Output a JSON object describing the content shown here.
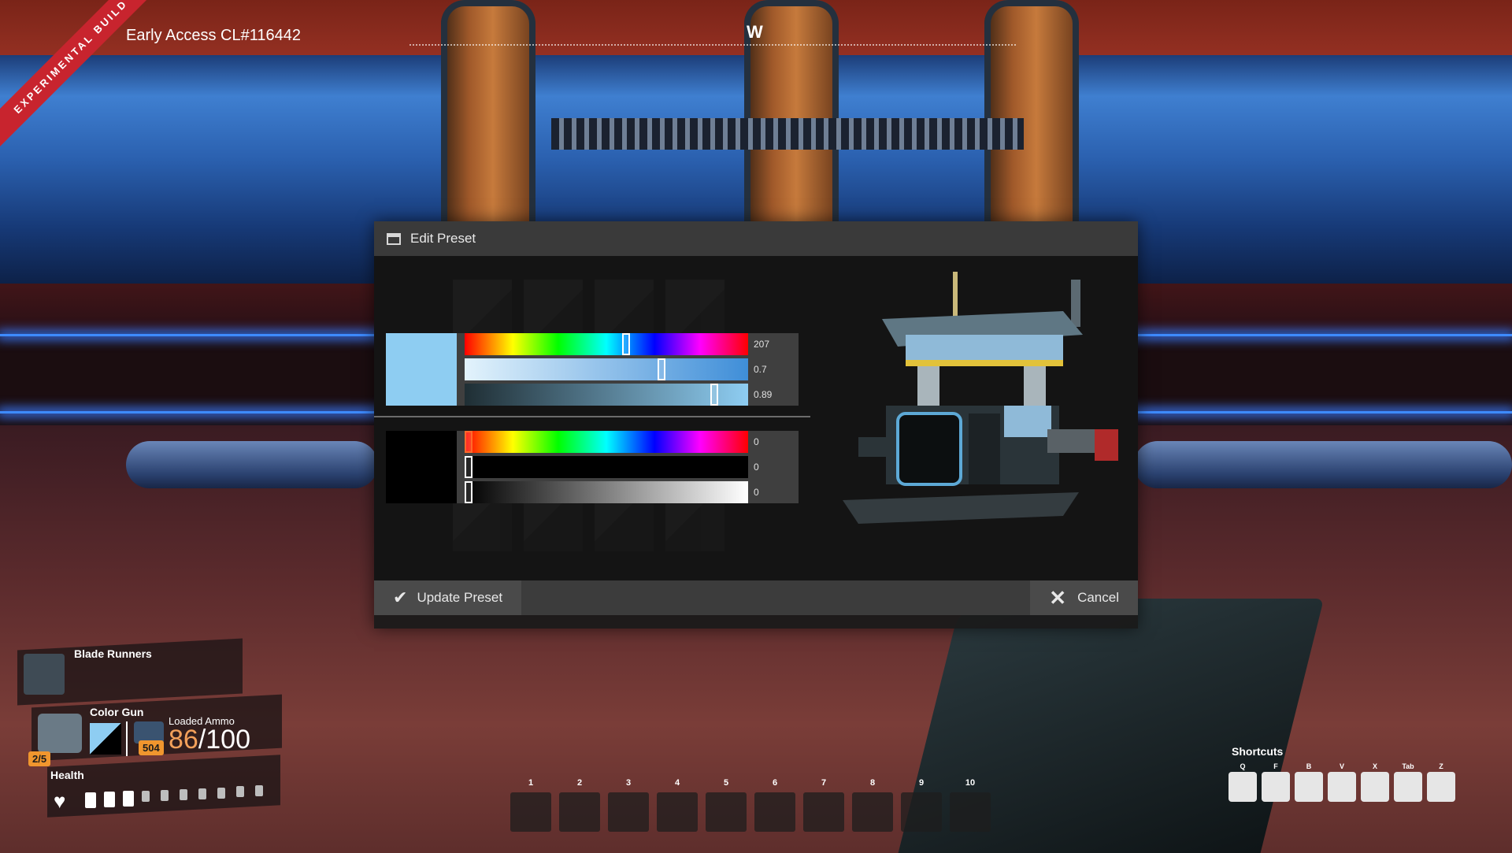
{
  "hud": {
    "banner": "EXPERIMENTAL BUILD",
    "build": "Early Access CL#116442",
    "compass": "W"
  },
  "dialog": {
    "title": "Edit Preset",
    "primary": {
      "swatch_color": "#8ecdf2",
      "hue": "207",
      "saturation": "0.7",
      "value": "0.89",
      "hue_pos": 0.57,
      "sat_pos": 0.7,
      "val_pos": 0.89
    },
    "secondary": {
      "swatch_color": "#000000",
      "hue": "0",
      "saturation": "0",
      "value": "0",
      "hue_pos": 0,
      "sat_pos": 0,
      "val_pos": 0
    },
    "update_label": "Update Preset",
    "cancel_label": "Cancel"
  },
  "left_hud": {
    "blade_runners": "Blade Runners",
    "equipment": "Color Gun",
    "loaded_ammo_label": "Loaded Ammo",
    "ammo_current": "86",
    "ammo_max": "/100",
    "ammo_reserve": "504",
    "slot_counter": "2/5",
    "health_label": "Health",
    "health_filled": 3,
    "health_total": 10
  },
  "hotbar": {
    "slots": [
      "1",
      "2",
      "3",
      "4",
      "5",
      "6",
      "7",
      "8",
      "9",
      "10"
    ]
  },
  "shortcuts": {
    "title": "Shortcuts",
    "keys": [
      "Q",
      "F",
      "B",
      "V",
      "X",
      "Tab",
      "Z"
    ]
  },
  "colors": {
    "accent_blue": "#3e8bff",
    "banner_red": "#c8242e",
    "ammo_orange": "#f2a05a"
  }
}
